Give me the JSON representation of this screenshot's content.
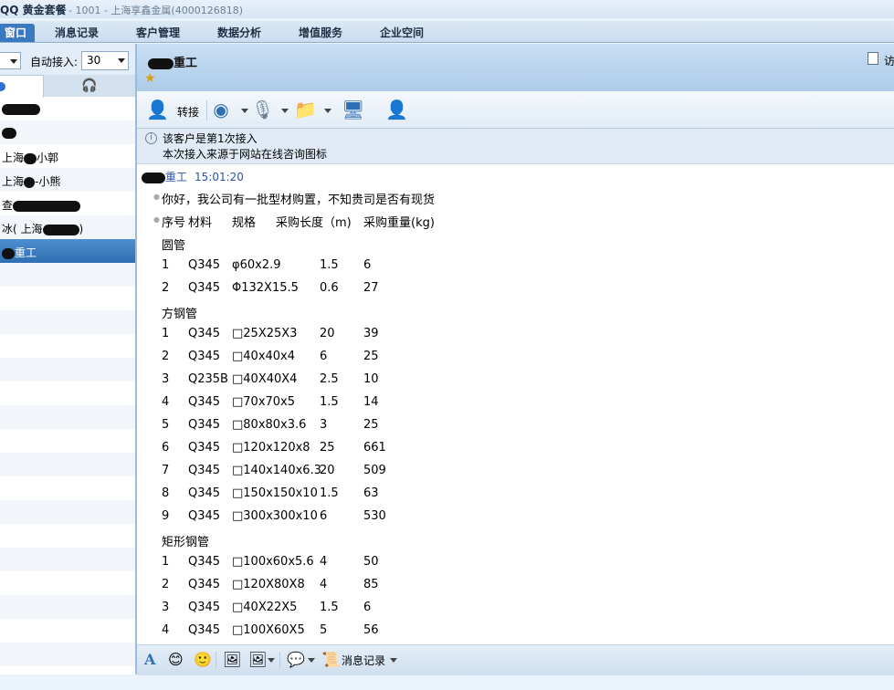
{
  "app": {
    "title": "QQ 黄金套餐",
    "subtitle": "- 1001 - 上海享鑫金属(4000126818)"
  },
  "tabs": [
    "窗口",
    "消息记录",
    "客户管理",
    "数据分析",
    "增值服务",
    "企业空间"
  ],
  "sidebar": {
    "auto_label": "自动接入:",
    "auto_value": "30",
    "contacts": [
      {
        "text": ""
      },
      {
        "text": ""
      },
      {
        "text": "上海",
        "suffix": "小郭"
      },
      {
        "text": "上海",
        "suffix": "-小熊"
      },
      {
        "text": "查",
        "suffix": ""
      },
      {
        "text": "冰( 上海",
        "suffix": ")"
      },
      {
        "text": "",
        "suffix": "重工"
      }
    ]
  },
  "chat": {
    "name": "重工",
    "transfer_label": "转接",
    "notice_line1": "该客户是第1次接入",
    "notice_line2": "本次接入来源于网站在线咨询图标",
    "header_right": "访",
    "message_sender": "重工",
    "message_time": "15:01:20",
    "greeting": "你好，我公司有一批型材购置，不知贵司是否有现货",
    "table_header": [
      "序号",
      "材料",
      "规格",
      "采购长度（m)",
      "采购重量(kg)"
    ],
    "sections": [
      {
        "title": "圆管",
        "rows": [
          [
            "1",
            "Q345",
            "φ60x2.9",
            "1.5",
            "6"
          ],
          [
            "2",
            "Q345",
            "Φ132X15.5",
            "0.6",
            "27"
          ]
        ]
      },
      {
        "title": "方钢管",
        "rows": [
          [
            "1",
            "Q345",
            "□25X25X3",
            "20",
            "39"
          ],
          [
            "2",
            "Q345",
            "□40x40x4",
            "6",
            "25"
          ],
          [
            "3",
            "Q235B",
            "□40X40X4",
            "2.5",
            "10"
          ],
          [
            "4",
            "Q345",
            "□70x70x5",
            "1.5",
            "14"
          ],
          [
            "5",
            "Q345",
            "□80x80x3.6",
            "3",
            "25"
          ],
          [
            "6",
            "Q345",
            "□120x120x8",
            "25",
            "661"
          ],
          [
            "7",
            "Q345",
            "□140x140x6.3",
            "20",
            "509"
          ],
          [
            "8",
            "Q345",
            "□150x150x10",
            "1.5",
            "63"
          ],
          [
            "9",
            "Q345",
            "□300x300x10",
            "6",
            "530"
          ]
        ]
      },
      {
        "title": "矩形钢管",
        "rows": [
          [
            "1",
            "Q345",
            "□100x60x5.6",
            "4",
            "50"
          ],
          [
            "2",
            "Q345",
            "□120X80X8",
            "4",
            "85"
          ],
          [
            "3",
            "Q345",
            "□40X22X5",
            "1.5",
            "6"
          ],
          [
            "4",
            "Q345",
            "□100X60X5",
            "5",
            "56"
          ]
        ]
      }
    ]
  },
  "bottom": {
    "history_label": "消息记录"
  },
  "colors": {
    "accent": "#3a78bf",
    "header_bg": "#aecce9",
    "sender": "#2b54a6"
  }
}
